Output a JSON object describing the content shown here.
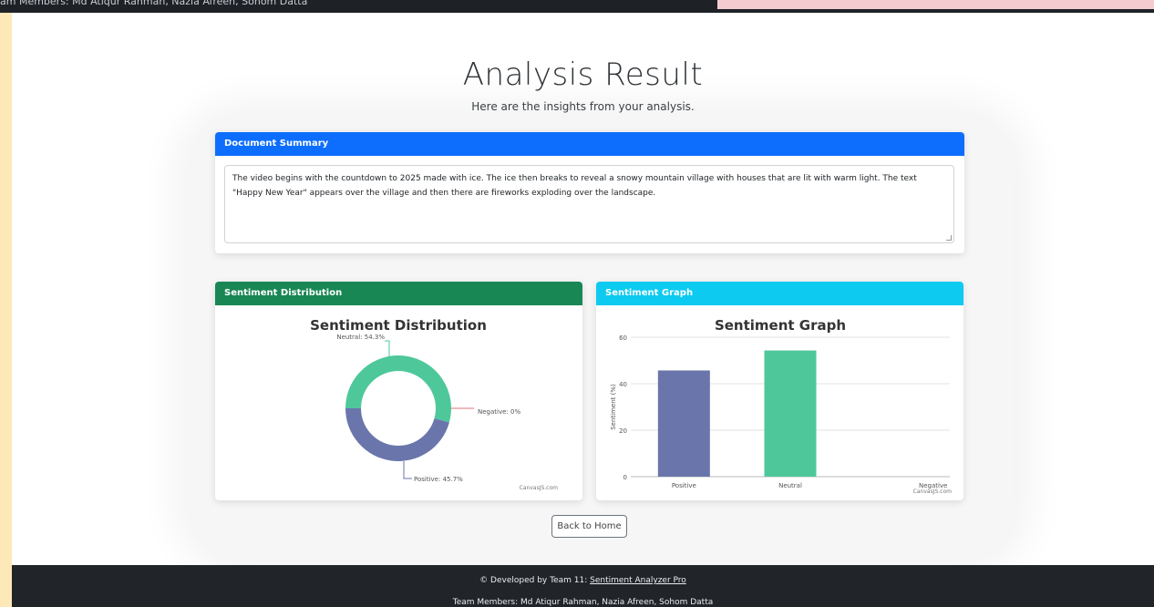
{
  "top_bar": {
    "team_text": "am Members: Md Atiqur Rahman, Nazia Afreen, Sohom Datta"
  },
  "header": {
    "title": "Analysis Result",
    "subtitle": "Here are the insights from your analysis."
  },
  "summary": {
    "header": "Document Summary",
    "text": "The video begins with the countdown to 2025 made with ice. The ice then breaks to reveal a snowy mountain village with houses that are lit with warm light. The text \"Happy New Year\" appears over the village and then there are fireworks exploding over the landscape."
  },
  "distribution": {
    "header": "Sentiment Distribution",
    "credit": "CanvasJS.com"
  },
  "graph": {
    "header": "Sentiment Graph",
    "credit": "CanvasJS.com"
  },
  "back_button": "Back to Home",
  "footer": {
    "dev_prefix": "© Developed by Team 11: ",
    "dev_link": "Sentiment Analyzer Pro",
    "team": "Team Members: Md Atiqur Rahman, Nazia Afreen, Sohom Datta"
  },
  "colors": {
    "positive": "#6a76ab",
    "neutral": "#4ec89a",
    "negative": "#e0707a",
    "summary_header": "#0d6efd",
    "distribution_header": "#198754",
    "graph_header": "#0dcaf0"
  },
  "chart_data": [
    {
      "type": "pie",
      "title": "Sentiment Distribution",
      "categories": [
        "Neutral",
        "Negative",
        "Positive"
      ],
      "values": [
        54.3,
        0,
        45.7
      ],
      "labels": [
        "Neutral: 54.3%",
        "Negative: 0%",
        "Positive: 45.7%"
      ]
    },
    {
      "type": "bar",
      "title": "Sentiment Graph",
      "categories": [
        "Positive",
        "Neutral",
        "Negative"
      ],
      "values": [
        45.7,
        54.3,
        0
      ],
      "ylabel": "Sentiment (%)",
      "ylim": [
        0,
        60
      ],
      "yticks": [
        0,
        20,
        40,
        60
      ],
      "grid": true
    }
  ]
}
